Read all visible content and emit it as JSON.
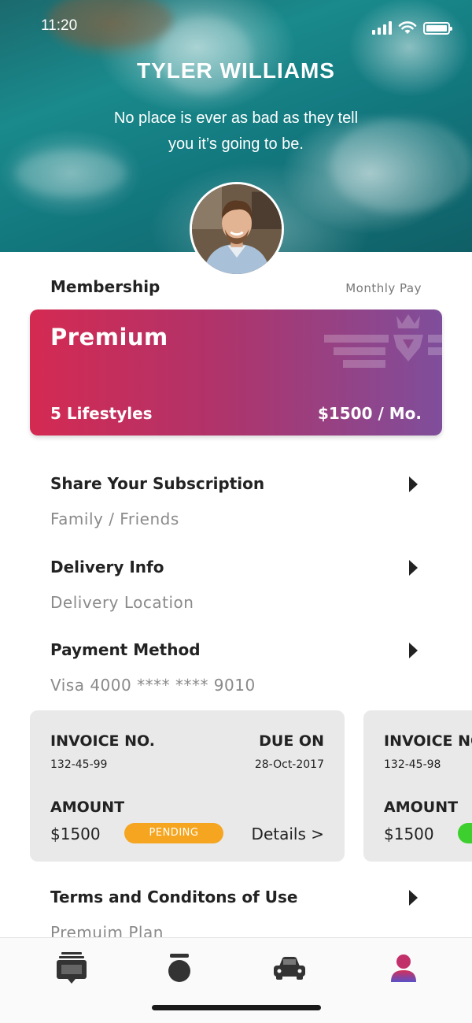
{
  "status_bar": {
    "time": "11:20"
  },
  "profile": {
    "name": "TYLER WILLIAMS",
    "quote_line1": "No place is ever as bad as they tell",
    "quote_line2": "you it’s going to be."
  },
  "membership": {
    "title": "Membership",
    "billing": "Monthly Pay",
    "plan": {
      "name": "Premium",
      "lifestyles": "5 Lifestyles",
      "price": "$1500 / Mo."
    }
  },
  "menu": [
    {
      "title": "Share Your Subscription",
      "subtitle": "Family / Friends"
    },
    {
      "title": "Delivery Info",
      "subtitle": "Delivery Location"
    },
    {
      "title": "Payment Method",
      "subtitle": "Visa 4000 **** **** 9010"
    },
    {
      "title": "Terms and Conditons of Use",
      "subtitle": "Premuim Plan"
    }
  ],
  "invoices": [
    {
      "invoice_label": "INVOICE NO.",
      "invoice_no": "132-45-99",
      "due_label": "DUE ON",
      "due_date": "28-Oct-2017",
      "amount_label": "AMOUNT",
      "amount": "$1500",
      "status": "PENDING",
      "status_color": "#f5a51f",
      "details": "Details >"
    },
    {
      "invoice_label": "INVOICE NO.",
      "invoice_no": "132-45-98",
      "amount_label": "AMOUNT",
      "amount": "$1500",
      "status_color": "#3ccf2e"
    }
  ],
  "tab_bar": {
    "tabs": [
      {
        "icon": "lifestyle-inbox-icon"
      },
      {
        "icon": "product-icon"
      },
      {
        "icon": "car-icon"
      },
      {
        "icon": "profile-icon",
        "active": true
      }
    ],
    "active_color": "#c2306a"
  }
}
